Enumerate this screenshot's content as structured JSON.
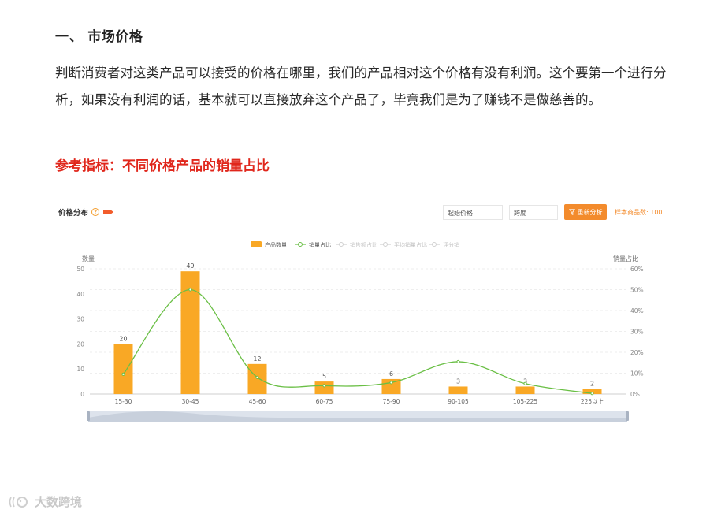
{
  "heading": "一、 市场价格",
  "paragraph": "判断消费者对这类产品可以接受的价格在哪里，我们的产品相对这个价格有没有利润。这个要第一个进行分析，如果没有利润的话，基本就可以直接放弃这个产品了，毕竟我们是为了赚钱不是做慈善的。",
  "ref_title": "参考指标：不同价格产品的销量占比",
  "panel": {
    "title": "价格分布",
    "help_icon": "?",
    "start_price_placeholder": "起始价格",
    "span_placeholder": "跨度",
    "reanalyze_label": "重新分析",
    "sample_label": "样本商品数: 100",
    "accent_color": "#f38b2c"
  },
  "chart_data": {
    "type": "bar",
    "categories": [
      "15-30",
      "30-45",
      "45-60",
      "60-75",
      "75-90",
      "90-105",
      "105-225",
      "225以上"
    ],
    "series": [
      {
        "name": "产品数量",
        "type": "bar",
        "axis": "left",
        "color": "#f9a825",
        "values": [
          20,
          49,
          12,
          5,
          6,
          3,
          3,
          2
        ]
      },
      {
        "name": "销量占比",
        "type": "line",
        "axis": "right",
        "color": "#6abf45",
        "values": [
          9.5,
          50,
          8,
          4,
          5.5,
          15.5,
          5,
          0.3
        ]
      }
    ],
    "legend": [
      "产品数量",
      "销量占比",
      "销售额占比",
      "平均销量占比",
      "评分销"
    ],
    "legend_active": [
      true,
      true,
      false,
      false,
      false
    ],
    "ylabel": "数量",
    "y2label": "销量占比",
    "ylim": [
      0,
      50
    ],
    "y2lim": [
      0,
      60
    ],
    "yticks": [
      "0",
      "10",
      "20",
      "30",
      "40",
      "50"
    ],
    "y2ticks": [
      "0%",
      "10%",
      "20%",
      "30%",
      "40%",
      "50%",
      "60%"
    ],
    "grid": true
  },
  "watermark": "大数跨境"
}
